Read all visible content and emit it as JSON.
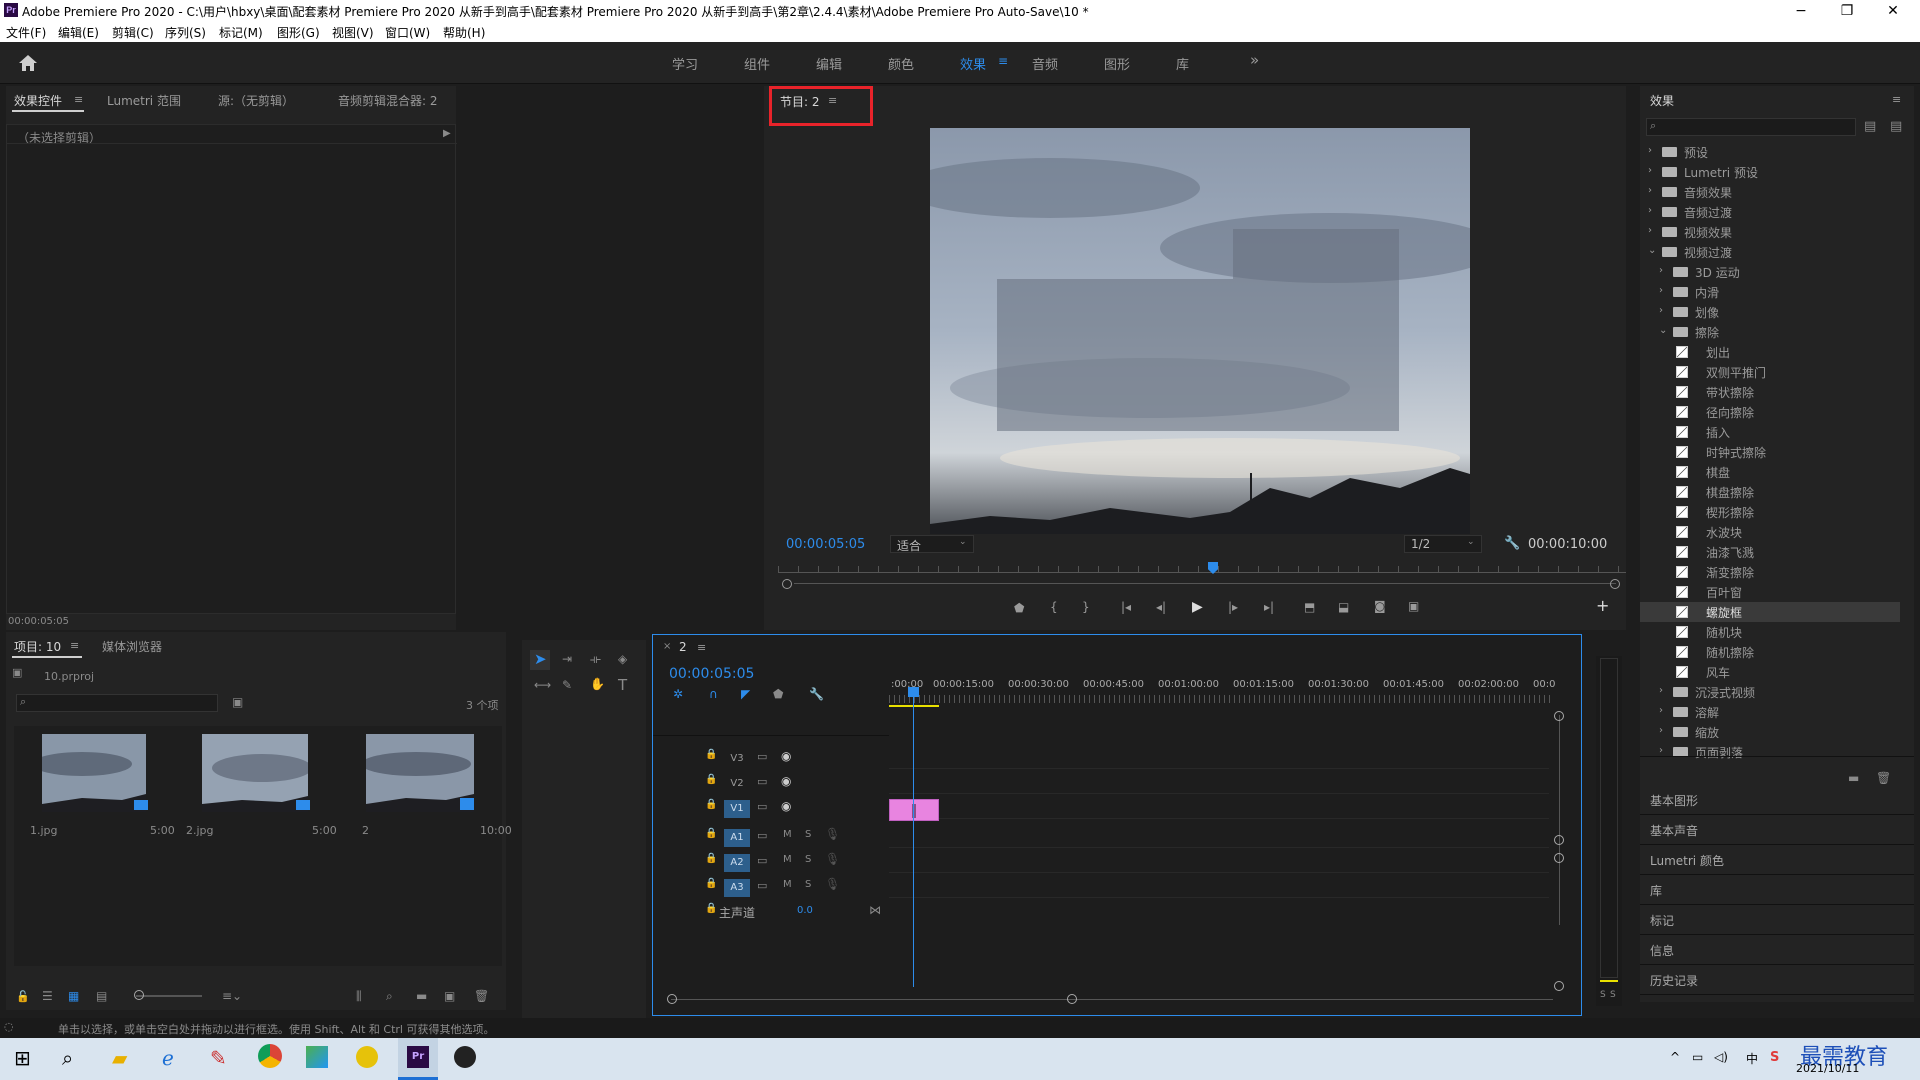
{
  "titlebar": {
    "logo": "Pr",
    "title": "Adobe Premiere Pro 2020 - C:\\用户\\hbxy\\桌面\\配套素材 Premiere Pro 2020 从新手到高手\\配套素材 Premiere Pro 2020 从新手到高手\\第2章\\2.4.4\\素材\\Adobe Premiere Pro Auto-Save\\10 *",
    "minimize": "−",
    "maximize": "❐",
    "close": "✕"
  },
  "menubar": [
    "文件(F)",
    "编辑(E)",
    "剪辑(C)",
    "序列(S)",
    "标记(M)",
    "图形(G)",
    "视图(V)",
    "窗口(W)",
    "帮助(H)"
  ],
  "workspaces": {
    "items": [
      "学习",
      "组件",
      "编辑",
      "颜色",
      "效果",
      "音频",
      "图形",
      "库"
    ],
    "active": "效果",
    "more": "»"
  },
  "source_panel": {
    "tabs": [
      "效果控件",
      "Lumetri 范围",
      "源:（无剪辑）",
      "音频剪辑混合器: 2"
    ],
    "no_clip": "（未选择剪辑）",
    "timecode": "00:00:05:05"
  },
  "program_monitor": {
    "tab": "节目: 2",
    "timecode": "00:00:05:05",
    "fit": "适合",
    "resolution": "1/2",
    "duration": "00:00:10:00"
  },
  "project_panel": {
    "tabs": [
      "项目: 10",
      "媒体浏览器"
    ],
    "project_file": "10.prproj",
    "count": "3 个项",
    "items": [
      {
        "name": "1.jpg",
        "duration": "5:00"
      },
      {
        "name": "2.jpg",
        "duration": "5:00"
      },
      {
        "name": "2",
        "duration": "10:00"
      }
    ]
  },
  "timeline": {
    "tab": "2",
    "timecode": "00:00:05:05",
    "ruler": [
      ":00:00",
      "00:00:15:00",
      "00:00:30:00",
      "00:00:45:00",
      "00:01:00:00",
      "00:01:15:00",
      "00:01:30:00",
      "00:01:45:00",
      "00:02:00:00",
      "00:0"
    ],
    "video_tracks": [
      "V3",
      "V2",
      "V1"
    ],
    "audio_tracks": [
      "A1",
      "A2",
      "A3"
    ],
    "mute": "M",
    "solo": "S",
    "master_label": "主声道",
    "master_value": "0.0"
  },
  "effects_panel": {
    "title": "效果",
    "tree": [
      {
        "label": "预设",
        "level": 0,
        "kind": "folder",
        "open": false
      },
      {
        "label": "Lumetri 预设",
        "level": 0,
        "kind": "folder",
        "open": false
      },
      {
        "label": "音频效果",
        "level": 0,
        "kind": "folder",
        "open": false
      },
      {
        "label": "音频过渡",
        "level": 0,
        "kind": "folder",
        "open": false
      },
      {
        "label": "视频效果",
        "level": 0,
        "kind": "folder",
        "open": false
      },
      {
        "label": "视频过渡",
        "level": 0,
        "kind": "folder",
        "open": true
      },
      {
        "label": "3D 运动",
        "level": 1,
        "kind": "folder",
        "open": false
      },
      {
        "label": "内滑",
        "level": 1,
        "kind": "folder",
        "open": false
      },
      {
        "label": "划像",
        "level": 1,
        "kind": "folder",
        "open": false
      },
      {
        "label": "擦除",
        "level": 1,
        "kind": "folder",
        "open": true
      },
      {
        "label": "划出",
        "level": 2,
        "kind": "fx"
      },
      {
        "label": "双侧平推门",
        "level": 2,
        "kind": "fx"
      },
      {
        "label": "带状擦除",
        "level": 2,
        "kind": "fx"
      },
      {
        "label": "径向擦除",
        "level": 2,
        "kind": "fx"
      },
      {
        "label": "插入",
        "level": 2,
        "kind": "fx"
      },
      {
        "label": "时钟式擦除",
        "level": 2,
        "kind": "fx"
      },
      {
        "label": "棋盘",
        "level": 2,
        "kind": "fx"
      },
      {
        "label": "棋盘擦除",
        "level": 2,
        "kind": "fx"
      },
      {
        "label": "楔形擦除",
        "level": 2,
        "kind": "fx"
      },
      {
        "label": "水波块",
        "level": 2,
        "kind": "fx"
      },
      {
        "label": "油漆飞溅",
        "level": 2,
        "kind": "fx"
      },
      {
        "label": "渐变擦除",
        "level": 2,
        "kind": "fx"
      },
      {
        "label": "百叶窗",
        "level": 2,
        "kind": "fx"
      },
      {
        "label": "螺旋框",
        "level": 2,
        "kind": "fx",
        "selected": true
      },
      {
        "label": "随机块",
        "level": 2,
        "kind": "fx"
      },
      {
        "label": "随机擦除",
        "level": 2,
        "kind": "fx"
      },
      {
        "label": "风车",
        "level": 2,
        "kind": "fx"
      },
      {
        "label": "沉浸式视频",
        "level": 1,
        "kind": "folder",
        "open": false
      },
      {
        "label": "溶解",
        "level": 1,
        "kind": "folder",
        "open": false
      },
      {
        "label": "缩放",
        "level": 1,
        "kind": "folder",
        "open": false
      },
      {
        "label": "页面剥落",
        "level": 1,
        "kind": "folder",
        "open": false
      }
    ],
    "sections": [
      "基本图形",
      "基本声音",
      "Lumetri 颜色",
      "库",
      "标记",
      "信息",
      "历史记录"
    ]
  },
  "meter": {
    "labels": [
      "S",
      "S"
    ]
  },
  "statusbar": "单击以选择，或单击空白处并拖动以进行框选。使用 Shift、Alt 和 Ctrl 可获得其他选项。",
  "taskbar": {
    "date": "2021/10/11",
    "watermark": "最需教育",
    "ime": "中"
  },
  "colors": {
    "accent": "#2d8ceb",
    "highlight_box": "#e8232a",
    "clip": "#e884e0"
  }
}
